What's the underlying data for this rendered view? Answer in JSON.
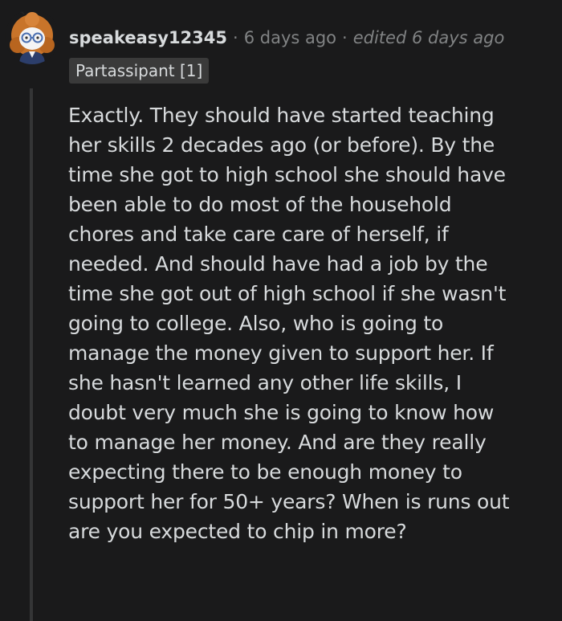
{
  "comment": {
    "username": "speakeasy12345",
    "separator": "·",
    "time": "6 days ago",
    "edited": "edited 6 days ago",
    "flair": "Partassipant [1]",
    "avatar_icon": "snoo-avatar-icon",
    "lines": [
      "Exactly. They should have started teaching",
      "her skills 2 decades ago (or before). By the",
      "time she got to high school she should have",
      "been able to do most of the household",
      "chores and take care care of herself, if",
      "needed. And should have had a job by the",
      "time she got out of high school if she wasn't",
      "going to college. Also, who is going to",
      "manage the money given to support her. If",
      "she hasn't learned any other life skills, I",
      "doubt very much she is going to know how",
      "to manage her money. And are they really",
      "expecting there to be enough money to",
      "support her for 50+ years? When is runs out",
      "are you expected to chip in more?"
    ]
  },
  "colors": {
    "background": "#1a1a1b",
    "text": "#d7dadc",
    "muted": "#818384",
    "flair_bg": "#3a3a3a",
    "thread_line": "#343536"
  }
}
